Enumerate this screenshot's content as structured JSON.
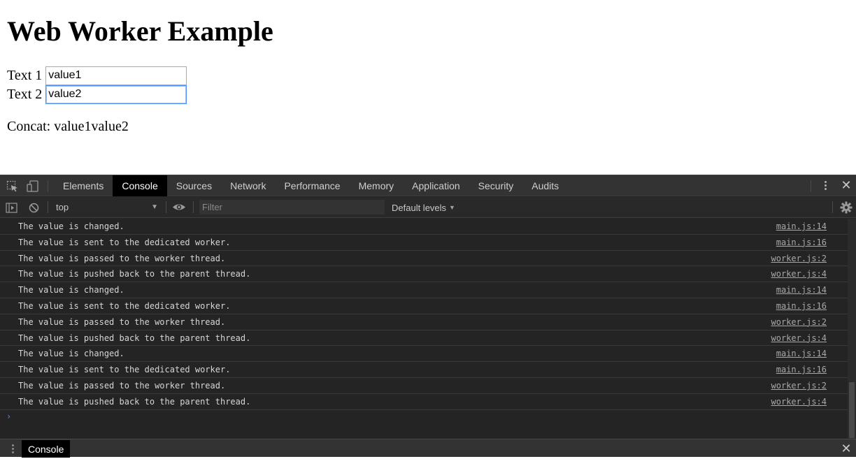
{
  "page": {
    "title": "Web Worker Example",
    "text1_label": "Text 1",
    "text1_value": "value1",
    "text2_label": "Text 2",
    "text2_value": "value2",
    "concat_text": "Concat: value1value2"
  },
  "devtools": {
    "tabs": [
      "Elements",
      "Console",
      "Sources",
      "Network",
      "Performance",
      "Memory",
      "Application",
      "Security",
      "Audits"
    ],
    "active_tab": "Console",
    "context": "top",
    "filter_placeholder": "Filter",
    "levels_label": "Default levels",
    "drawer_tab": "Console",
    "icons": {
      "inspect": "inspect-element-icon",
      "device": "device-toolbar-icon",
      "sidebar": "show-sidebar-icon",
      "clear": "clear-console-icon",
      "eye": "live-expression-icon",
      "settings": "gear-icon",
      "more": "kebab-menu-icon",
      "close": "close-icon"
    },
    "logs": [
      {
        "msg": "The value is changed.",
        "src": "main.js:14"
      },
      {
        "msg": "The value is sent to the dedicated worker.",
        "src": "main.js:16"
      },
      {
        "msg": "The value is passed to the worker thread.",
        "src": "worker.js:2"
      },
      {
        "msg": "The value is pushed back to the parent thread.",
        "src": "worker.js:4"
      },
      {
        "msg": "The value is changed.",
        "src": "main.js:14"
      },
      {
        "msg": "The value is sent to the dedicated worker.",
        "src": "main.js:16"
      },
      {
        "msg": "The value is passed to the worker thread.",
        "src": "worker.js:2"
      },
      {
        "msg": "The value is pushed back to the parent thread.",
        "src": "worker.js:4"
      },
      {
        "msg": "The value is changed.",
        "src": "main.js:14"
      },
      {
        "msg": "The value is sent to the dedicated worker.",
        "src": "main.js:16"
      },
      {
        "msg": "The value is passed to the worker thread.",
        "src": "worker.js:2"
      },
      {
        "msg": "The value is pushed back to the parent thread.",
        "src": "worker.js:4"
      }
    ]
  }
}
